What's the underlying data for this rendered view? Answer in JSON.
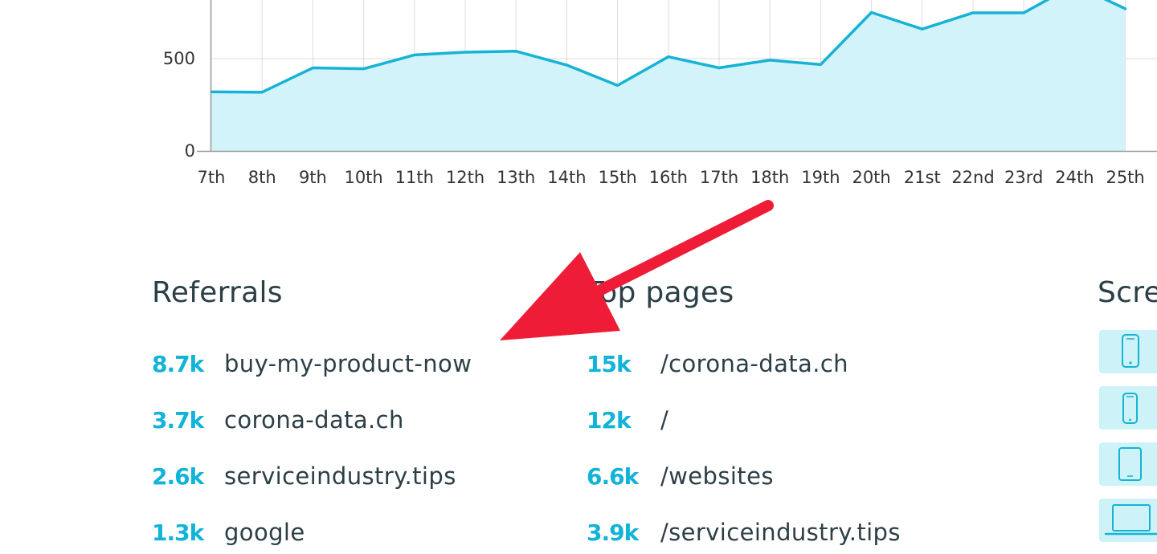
{
  "chart_data": {
    "type": "area",
    "categories": [
      "7th",
      "8th",
      "9th",
      "10th",
      "11th",
      "12th",
      "13th",
      "14th",
      "15th",
      "16th",
      "17th",
      "18th",
      "19th",
      "20th",
      "21st",
      "22nd",
      "23rd",
      "24th",
      "25th"
    ],
    "values": [
      320,
      318,
      450,
      445,
      520,
      535,
      540,
      465,
      355,
      510,
      450,
      492,
      468,
      750,
      660,
      748,
      748,
      900,
      770
    ],
    "yticks": [
      0,
      500
    ],
    "xlabel": "",
    "ylabel": "",
    "grid": true,
    "colors": {
      "line": "#17b3d6",
      "fill": "#d2f3f9",
      "grid": "#dcdcdc",
      "axis": "#9a9a9a"
    }
  },
  "referrals": {
    "title": "Referrals",
    "items": [
      {
        "count": "8.7k",
        "name": "buy-my-product-now"
      },
      {
        "count": "3.7k",
        "name": "corona-data.ch"
      },
      {
        "count": "2.6k",
        "name": "serviceindustry.tips"
      },
      {
        "count": "1.3k",
        "name": "google"
      }
    ]
  },
  "top_pages": {
    "title": "Top pages",
    "items": [
      {
        "count": "15k",
        "path": "/corona-data.ch"
      },
      {
        "count": "12k",
        "path": "/"
      },
      {
        "count": "6.6k",
        "path": "/websites"
      },
      {
        "count": "3.9k",
        "path": "/serviceindustry.tips"
      }
    ]
  },
  "screens": {
    "title": "Screens",
    "icons": [
      "phone-icon",
      "small-phone-icon",
      "tablet-icon",
      "laptop-icon"
    ]
  },
  "annotation": {
    "icon": "red-arrow-icon",
    "color": "#ee1c37"
  }
}
